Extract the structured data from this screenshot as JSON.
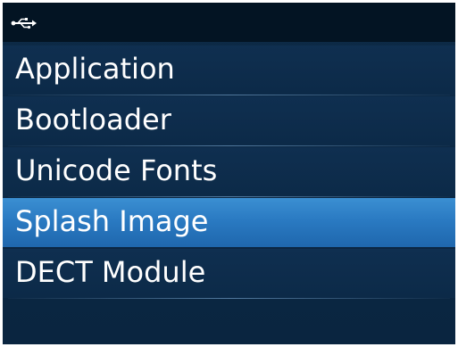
{
  "status_bar": {
    "icon": "usb-icon"
  },
  "menu": {
    "items": [
      {
        "label": "Application",
        "selected": false
      },
      {
        "label": "Bootloader",
        "selected": false
      },
      {
        "label": "Unicode Fonts",
        "selected": false
      },
      {
        "label": "Splash Image",
        "selected": true
      },
      {
        "label": "DECT Module",
        "selected": false
      }
    ]
  },
  "colors": {
    "background": "#0c2a48",
    "status_bar": "#031423",
    "selection": "#2a7ac2",
    "text": "#ffffff"
  }
}
